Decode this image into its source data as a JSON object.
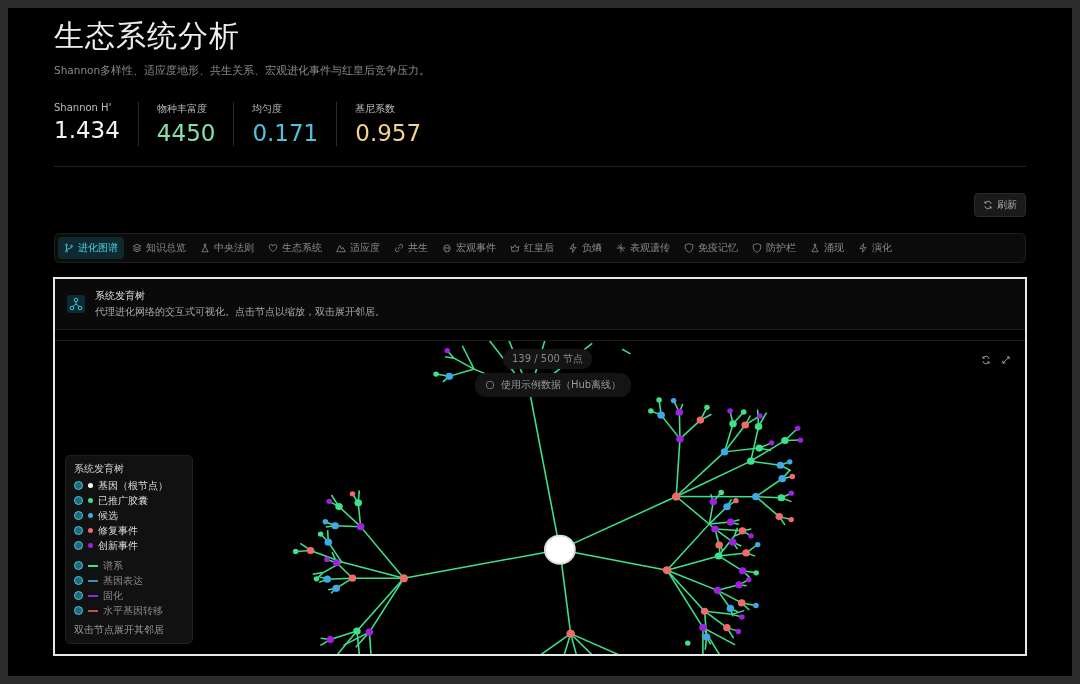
{
  "title": "生态系统分析",
  "subtitle": "Shannon多样性、适应度地形、共生关系、宏观进化事件与红皇后竞争压力。",
  "stats": [
    {
      "label": "Shannon H'",
      "value": "1.434",
      "color": "#f2f2f2"
    },
    {
      "label": "物种丰富度",
      "value": "4450",
      "color": "#86e0a6"
    },
    {
      "label": "均匀度",
      "value": "0.171",
      "color": "#4cc3e0"
    },
    {
      "label": "基尼系数",
      "value": "0.957",
      "color": "#f2d48a"
    }
  ],
  "refresh_button": "刷新",
  "tabs": [
    {
      "label": "进化图谱",
      "selected": true
    },
    {
      "label": "知识总览",
      "selected": false
    },
    {
      "label": "中央法则",
      "selected": false
    },
    {
      "label": "生态系统",
      "selected": false
    },
    {
      "label": "适应度",
      "selected": false
    },
    {
      "label": "共生",
      "selected": false
    },
    {
      "label": "宏观事件",
      "selected": false
    },
    {
      "label": "红皇后",
      "selected": false
    },
    {
      "label": "负熵",
      "selected": false
    },
    {
      "label": "表观遗传",
      "selected": false
    },
    {
      "label": "免疫记忆",
      "selected": false
    },
    {
      "label": "防护栏",
      "selected": false
    },
    {
      "label": "涌现",
      "selected": false
    },
    {
      "label": "演化",
      "selected": false
    }
  ],
  "panel": {
    "title": "系统发育树",
    "description": "代理进化网络的交互式可视化。点击节点以缩放，双击展开邻居。",
    "node_count": "139 / 500 节点",
    "data_notice": "使用示例数据（Hub离线）",
    "legend": {
      "title": "系统发育树",
      "nodes": [
        {
          "label": "基因（根节点）",
          "color": "#ffffff",
          "on": true
        },
        {
          "label": "已推广胶囊",
          "color": "#3ee08a",
          "on": true
        },
        {
          "label": "候选",
          "color": "#3ea8e8",
          "on": true
        },
        {
          "label": "修复事件",
          "color": "#f06a6a",
          "on": true
        },
        {
          "label": "创新事件",
          "color": "#a020e0",
          "on": true
        }
      ],
      "edges": [
        {
          "label": "谱系",
          "color": "#3ee08a",
          "on": true
        },
        {
          "label": "基因表达",
          "color": "#3e8fb8",
          "on": true
        },
        {
          "label": "固化",
          "color": "#8a2be2",
          "on": true
        },
        {
          "label": "水平基因转移",
          "color": "#c05050",
          "on": true
        }
      ],
      "hint": "双击节点展开其邻居"
    }
  }
}
